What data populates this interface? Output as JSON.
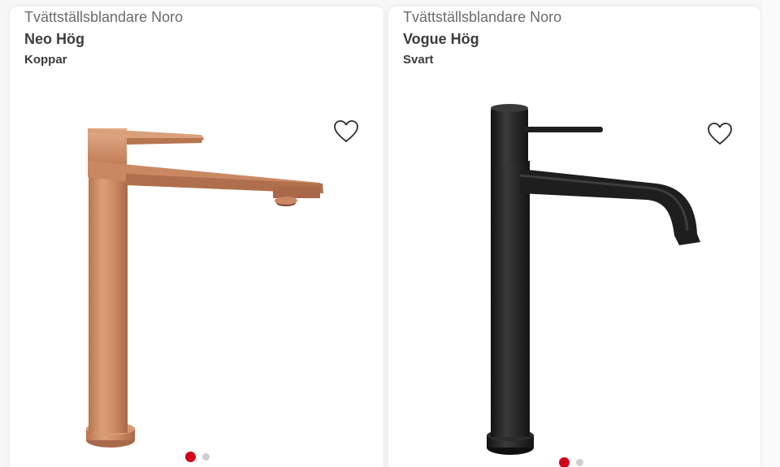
{
  "products": [
    {
      "brand": "Tvättställsblandare Noro",
      "name": "Neo Hög",
      "finish": "Koppar",
      "image_icon": "copper-faucet-image",
      "favorite_icon": "heart-icon",
      "carousel": {
        "total": 2,
        "active_index": 0
      }
    },
    {
      "brand": "Tvättställsblandare Noro",
      "name": "Vogue Hög",
      "finish": "Svart",
      "image_icon": "black-faucet-image",
      "favorite_icon": "heart-icon",
      "carousel": {
        "total": 2,
        "active_index": 0
      }
    }
  ],
  "colors": {
    "dot_active": "#d0021b",
    "dot_inactive": "#cfcfcf",
    "copper": "#c98a62",
    "black_finish": "#1e1e1e"
  }
}
